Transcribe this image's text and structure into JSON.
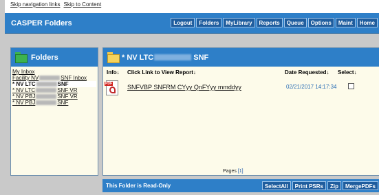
{
  "skip": {
    "nav": "Skip navigation links",
    "content": "Skip to Content"
  },
  "header": {
    "title": "CASPER Folders",
    "nav_buttons": [
      "Logout",
      "Folders",
      "MyLibrary",
      "Reports",
      "Queue",
      "Options",
      "Maint",
      "Home"
    ]
  },
  "sidebar": {
    "title": "Folders",
    "items": [
      {
        "pre": "My Inbox",
        "post": ""
      },
      {
        "pre": "Facility NV",
        "post": "SNF Inbox"
      },
      {
        "pre": "* NV LTC",
        "post": "SNF"
      },
      {
        "pre": "* NV LTC",
        "post": "SNF VR"
      },
      {
        "pre": "* NV PBJ",
        "post": "SNF VR"
      },
      {
        "pre": "* NV PBJ",
        "post": "SNF"
      }
    ]
  },
  "main": {
    "folder_title_pre": "* NV LTC",
    "folder_title_post": "SNF",
    "columns": {
      "info": "Info↓",
      "link": "Click Link to View Report↓",
      "date": "Date Requested↓",
      "select": "Select↓"
    },
    "report": {
      "name": "SNFVBP SNFRM CYyy QnFYyy mmddyy",
      "date": "02/21/2017 14:17:34"
    },
    "pages_label": "Pages",
    "pages_current": "[1]"
  },
  "footer": {
    "readonly": "This Folder is Read-Only",
    "buttons": [
      "SelectAll",
      "Print PSRs",
      "Zip",
      "MergePDFs"
    ]
  }
}
